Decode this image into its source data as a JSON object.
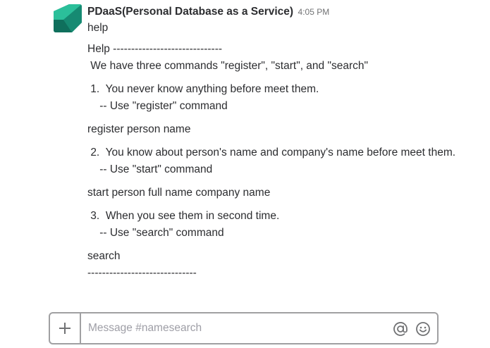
{
  "message": {
    "sender": "PDaaS(Personal Database as a Service)",
    "time": "4:05 PM",
    "lines": {
      "l0": "help",
      "l1": "Help ------------------------------",
      "l2": " We have three commands \"register\", \"start\", and \"search\"",
      "l3": " 1.  You never know anything before meet them.",
      "l4": "    -- Use \"register\" command",
      "l5": "register person name",
      "l6": " 2.  You know about person's name and company's name before meet them.",
      "l7": "    -- Use \"start\" command",
      "l8": "start person full name company name",
      "l9": " 3.  When you see them in second time.",
      "l10": "    -- Use \"search\" command",
      "l11": "search",
      "l12": "------------------------------"
    }
  },
  "composer": {
    "placeholder": "Message #namesearch",
    "plus_icon": "plus-icon",
    "mention_icon": "at-sign-icon",
    "emoji_icon": "smiley-icon"
  },
  "colors": {
    "avatar_primary": "#1aa184",
    "avatar_secondary": "#2a9d8f",
    "border": "#a0a0a2",
    "text": "#2c2d30",
    "muted": "#717274"
  }
}
